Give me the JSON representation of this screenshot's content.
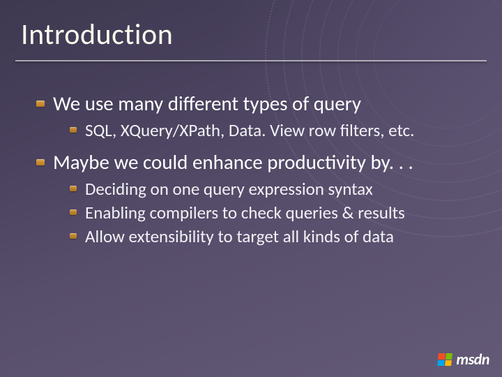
{
  "title": "Introduction",
  "bullets": [
    {
      "text": "We use many different types of query",
      "children": [
        "SQL, XQuery/XPath, Data. View row filters, etc."
      ]
    },
    {
      "text": "Maybe we could enhance productivity by. . .",
      "children": [
        "Deciding on one query expression syntax",
        "Enabling compilers to check queries & results",
        "Allow extensibility to target all kinds of data"
      ]
    }
  ],
  "footer": {
    "logo_text": "msdn"
  }
}
